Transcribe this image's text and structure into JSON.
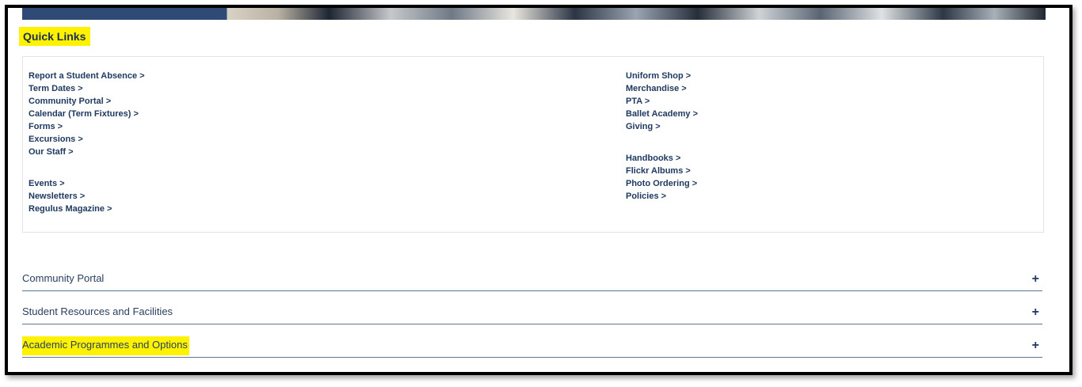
{
  "quick_links": {
    "title": "Quick Links",
    "left_column": {
      "group1": [
        "Report a Student Absence >",
        "Term Dates >",
        "Community Portal >",
        "Calendar (Term Fixtures) >",
        "Forms >",
        "Excursions >",
        "Our Staff >"
      ],
      "group2": [
        "Events >",
        "Newsletters >",
        "Regulus Magazine >"
      ]
    },
    "right_column": {
      "group1": [
        "Uniform Shop >",
        "Merchandise >",
        "PTA >",
        "Ballet Academy >",
        "Giving >"
      ],
      "group2": [
        "Handbooks >",
        "Flickr Albums >",
        "Photo Ordering >",
        "Policies >"
      ]
    }
  },
  "accordion": [
    {
      "label": "Community Portal",
      "icon": "plus-icon",
      "symbol": "+"
    },
    {
      "label": "Student Resources and Facilities",
      "icon": "plus-icon",
      "symbol": "+"
    },
    {
      "label": "Academic Programmes and Options",
      "icon": "plus-icon",
      "symbol": "+"
    }
  ],
  "colors": {
    "highlight": "#fff200",
    "link": "#1f3a60",
    "divider": "#5f7594"
  }
}
